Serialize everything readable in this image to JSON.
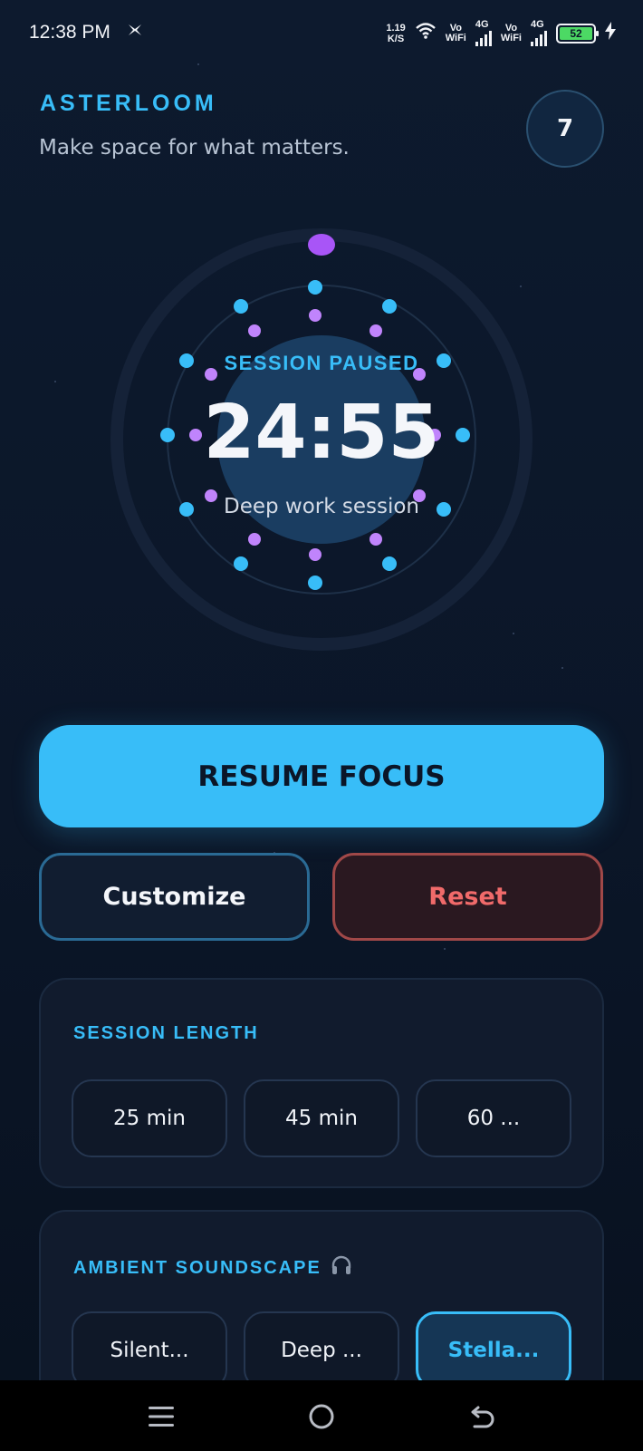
{
  "status_bar": {
    "time": "12:38 PM",
    "notification_icon": "app-notification-icon",
    "speed_value": "1.19",
    "speed_unit": "K/S",
    "wifi_icon": "wifi-icon",
    "sim1_label_top": "Vo",
    "sim1_label_bottom": "WiFi",
    "sim1_network": "4G",
    "sim2_label_top": "Vo",
    "sim2_label_bottom": "WiFi",
    "sim2_network": "4G",
    "battery_level": "52",
    "charging_icon": "charging-bolt-icon"
  },
  "header": {
    "brand": "ASTERLOOM",
    "tagline": "Make space for what matters.",
    "streak_count": "7"
  },
  "timer": {
    "status": "SESSION PAUSED",
    "time_remaining": "24:55",
    "session_label": "Deep work session",
    "colors": {
      "accent": "#38bdf8",
      "handle": "#a855f7",
      "dots_secondary": "#c084fc"
    }
  },
  "actions": {
    "primary": "RESUME FOCUS",
    "customize": "Customize",
    "reset": "Reset"
  },
  "session_length": {
    "title": "SESSION LENGTH",
    "options": [
      "25 min",
      "45 min",
      "60 ..."
    ]
  },
  "soundscape": {
    "title": "AMBIENT SOUNDSCAPE",
    "title_icon": "headphones-icon",
    "options": [
      "Silent...",
      "Deep ...",
      "Stella..."
    ],
    "selected": "Stella..."
  },
  "nav_bar": {
    "menu_icon": "menu-icon",
    "home_icon": "home-icon",
    "back_icon": "back-icon"
  }
}
